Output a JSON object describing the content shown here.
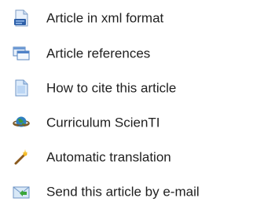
{
  "links": [
    {
      "label": "Article in xml format",
      "icon": "xml-document-icon"
    },
    {
      "label": "Article references",
      "icon": "references-window-icon"
    },
    {
      "label": "How to cite this article",
      "icon": "cite-document-icon"
    },
    {
      "label": "Curriculum ScienTI",
      "icon": "globe-icon"
    },
    {
      "label": "Automatic translation",
      "icon": "magic-wand-icon"
    },
    {
      "label": "Send this article by e-mail",
      "icon": "email-envelope-icon"
    }
  ]
}
